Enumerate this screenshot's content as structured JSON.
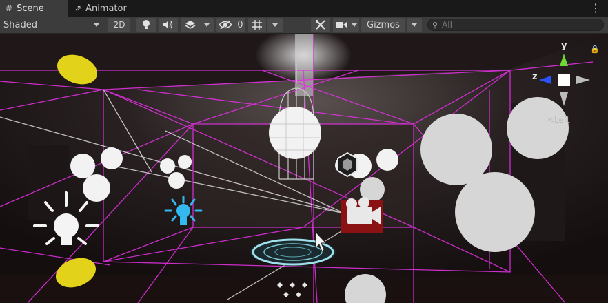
{
  "tabs": [
    {
      "label": "Scene",
      "icon": "grid-icon",
      "active": true
    },
    {
      "label": "Animator",
      "icon": "animator-icon",
      "active": false
    }
  ],
  "toolbar": {
    "shading_mode": "Shaded",
    "toggle_2d": "2D",
    "hidden_count": "0",
    "gizmos_label": "Gizmos",
    "search_placeholder": "All"
  },
  "orientation_gizmo": {
    "y_label": "y",
    "z_label": "z",
    "view_label": "Left"
  },
  "colors": {
    "toolbar_bg": "#3c3c3c",
    "tab_bg": "#191919",
    "wireframe": "#e030e0",
    "axis_y": "#6dd832",
    "axis_z": "#2a52ff",
    "light_gizmo": "#f4f4f4",
    "selected_light": "#34b8f0"
  }
}
